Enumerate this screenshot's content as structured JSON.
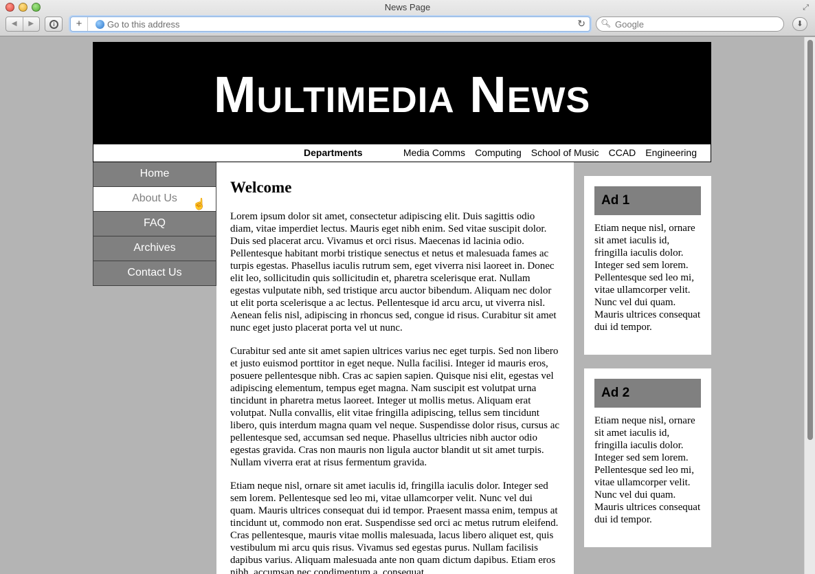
{
  "browser": {
    "window_title": "News Page",
    "address_placeholder": "Go to this address",
    "search_placeholder": "Google",
    "icons": {
      "back": "back-arrow-icon",
      "forward": "forward-arrow-icon",
      "reader": "reader-icon",
      "add_bookmark": "plus-icon",
      "site": "globe-icon",
      "reload": "reload-icon",
      "search": "search-icon",
      "downloads": "download-icon",
      "fullscreen": "fullscreen-icon"
    }
  },
  "site": {
    "title": "Multimedia News"
  },
  "departments": {
    "heading": "Departments",
    "links": [
      "Media Comms",
      "Computing",
      "School of Music",
      "CCAD",
      "Engineering"
    ]
  },
  "nav": {
    "items": [
      "Home",
      "About Us",
      "FAQ",
      "Archives",
      "Contact Us"
    ],
    "active": "About Us"
  },
  "main": {
    "heading": "Welcome",
    "paragraphs": [
      "Lorem ipsum dolor sit amet, consectetur adipiscing elit. Duis sagittis odio diam, vitae imperdiet lectus. Mauris eget nibh enim. Sed vitae suscipit dolor. Duis sed placerat arcu. Vivamus et orci risus. Maecenas id lacinia odio. Pellentesque habitant morbi tristique senectus et netus et malesuada fames ac turpis egestas. Phasellus iaculis rutrum sem, eget viverra nisi laoreet in. Donec elit leo, sollicitudin quis sollicitudin et, pharetra scelerisque erat. Nullam egestas vulputate nibh, sed tristique arcu auctor bibendum. Aliquam nec dolor ut elit porta scelerisque a ac lectus. Pellentesque id arcu arcu, ut viverra nisl. Aenean felis nisl, adipiscing in rhoncus sed, congue id risus. Curabitur sit amet nunc eget justo placerat porta vel ut nunc.",
      "Curabitur sed ante sit amet sapien ultrices varius nec eget turpis. Sed non libero et justo euismod porttitor in eget neque. Nulla facilisi. Integer id mauris eros, posuere pellentesque nibh. Cras ac sapien sapien. Quisque nisi elit, egestas vel adipiscing elementum, tempus eget magna. Nam suscipit est volutpat urna tincidunt in pharetra metus laoreet. Integer ut mollis metus. Aliquam erat volutpat. Nulla convallis, elit vitae fringilla adipiscing, tellus sem tincidunt libero, quis interdum magna quam vel neque. Suspendisse dolor risus, cursus ac pellentesque sed, accumsan sed neque. Phasellus ultricies nibh auctor odio egestas gravida. Cras non mauris non ligula auctor blandit ut sit amet turpis. Nullam viverra erat at risus fermentum gravida.",
      "Etiam neque nisl, ornare sit amet iaculis id, fringilla iaculis dolor. Integer sed sem lorem. Pellentesque sed leo mi, vitae ullamcorper velit. Nunc vel dui quam. Mauris ultrices consequat dui id tempor. Praesent massa enim, tempus at tincidunt ut, commodo non erat. Suspendisse sed orci ac metus rutrum eleifend. Cras pellentesque, mauris vitae mollis malesuada, lacus libero aliquet est, quis vestibulum mi arcu quis risus. Vivamus sed egestas purus. Nullam facilisis dapibus varius. Aliquam malesuada ante non quam dictum dapibus. Etiam eros nibh, accumsan nec condimentum a, consequat"
    ]
  },
  "ads": [
    {
      "title": "Ad 1",
      "text": "Etiam neque nisl, ornare sit amet iaculis id, fringilla iaculis dolor. Integer sed sem lorem. Pellentesque sed leo mi, vitae ullamcorper velit. Nunc vel dui quam. Mauris ultrices consequat dui id tempor."
    },
    {
      "title": "Ad 2",
      "text": "Etiam neque nisl, ornare sit amet iaculis id, fringilla iaculis dolor. Integer sed sem lorem. Pellentesque sed leo mi, vitae ullamcorper velit. Nunc vel dui quam. Mauris ultrices consequat dui id tempor."
    }
  ],
  "colors": {
    "masthead": "#000000",
    "nav_background": "#808080",
    "nav_active_background": "#ffffff",
    "page_background": "#b4b4b4"
  }
}
